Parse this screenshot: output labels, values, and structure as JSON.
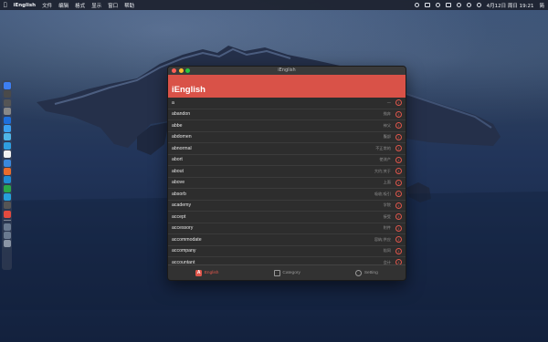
{
  "menubar": {
    "app_name": "iEnglish",
    "menus": [
      "文件",
      "编辑",
      "格式",
      "显示",
      "窗口",
      "帮助"
    ],
    "datetime": "4月12日 周日 19:21",
    "input_method": "简"
  },
  "window": {
    "title": "iEnglish",
    "header": "iEnglish"
  },
  "words": [
    {
      "word": "a",
      "meaning": "一"
    },
    {
      "word": "abandon",
      "meaning": "抛弃"
    },
    {
      "word": "abbe",
      "meaning": "神父"
    },
    {
      "word": "abdomen",
      "meaning": "腹部"
    },
    {
      "word": "abnormal",
      "meaning": "不正常的"
    },
    {
      "word": "abort",
      "meaning": "使流产"
    },
    {
      "word": "about",
      "meaning": "大约;关于"
    },
    {
      "word": "above",
      "meaning": "上面"
    },
    {
      "word": "absorb",
      "meaning": "吸收;吸引"
    },
    {
      "word": "academy",
      "meaning": "学院"
    },
    {
      "word": "accept",
      "meaning": "接受"
    },
    {
      "word": "accessory",
      "meaning": "附件"
    },
    {
      "word": "accommodate",
      "meaning": "容纳;供应"
    },
    {
      "word": "accompany",
      "meaning": "陪同"
    },
    {
      "word": "accountant",
      "meaning": "会计"
    }
  ],
  "tabs": [
    {
      "label": "English",
      "icon": "english-book-icon",
      "active": true
    },
    {
      "label": "Category",
      "icon": "category-icon",
      "active": false
    },
    {
      "label": "Setting",
      "icon": "setting-icon",
      "active": false
    }
  ],
  "colors": {
    "accent": "#d95248",
    "window_bg": "#2d2d2d"
  }
}
